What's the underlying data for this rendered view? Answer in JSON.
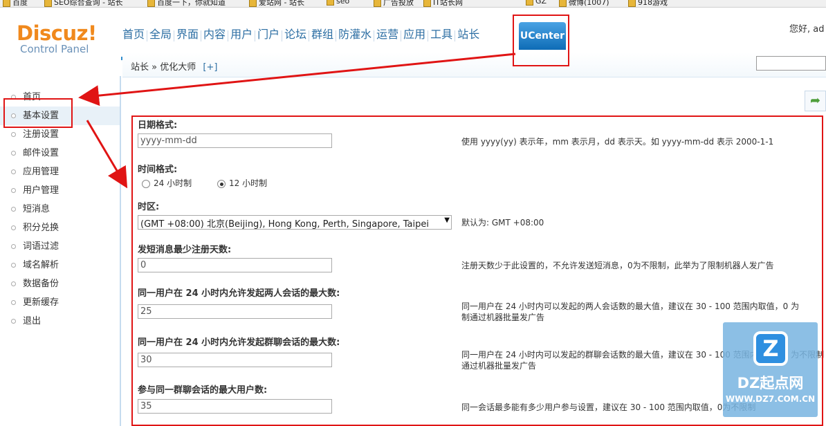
{
  "bookmarks": [
    "百度",
    "SEO综合查询 - 站长",
    "百度一下，你就知道",
    "爱站网 - 站长",
    "seo",
    "广告投放",
    "IT站长网",
    "GZ",
    "微博(1007)",
    "918游戏"
  ],
  "logo": {
    "main": "Discuz!",
    "sub": "Control Panel"
  },
  "nav": {
    "items": [
      "首页",
      "全局",
      "界面",
      "内容",
      "用户",
      "门户",
      "论坛",
      "群组",
      "防灌水",
      "运营",
      "应用",
      "工具",
      "站长"
    ],
    "active": "UCenter"
  },
  "user": {
    "greeting": "您好, ad"
  },
  "breadcrumb": {
    "root": "站长",
    "sep": "»",
    "current": "优化大师",
    "plus": "[+]"
  },
  "sidebar": {
    "items": [
      "首页",
      "基本设置",
      "注册设置",
      "邮件设置",
      "应用管理",
      "用户管理",
      "短消息",
      "积分兑换",
      "词语过滤",
      "域名解析",
      "数据备份",
      "更新缓存",
      "退出"
    ],
    "active_index": 1
  },
  "form": {
    "date_format": {
      "label": "日期格式:",
      "value": "yyyy-mm-dd",
      "tip": "使用 yyyy(yy) 表示年，mm 表示月，dd 表示天。如 yyyy-mm-dd 表示 2000-1-1"
    },
    "time_format": {
      "label": "时间格式:",
      "opt24": "24 小时制",
      "opt12": "12 小时制",
      "selected": "12"
    },
    "timezone": {
      "label": "时区:",
      "value": "(GMT +08:00) 北京(Beijing), Hong Kong, Perth, Singapore, Taipei",
      "tip": "默认为: GMT +08:00"
    },
    "pm_min_days": {
      "label": "发短消息最少注册天数:",
      "value": "0",
      "tip": "注册天数少于此设置的，不允许发送短消息，0为不限制，此举为了限制机器人发广告"
    },
    "pm_max_private": {
      "label": "同一用户在 24 小时内允许发起两人会话的最大数:",
      "value": "25",
      "tip1": "同一用户在 24 小时内可以发起的两人会话数的最大值，建议在 30 - 100 范围内取值，0 为",
      "tip2": "制通过机器批量发广告"
    },
    "pm_max_group": {
      "label": "同一用户在 24 小时内允许发起群聊会话的最大数:",
      "value": "30",
      "tip1": "同一用户在 24 小时内可以发起的群聊会话数的最大值，建议在 30 - 100 范围内取值，0 为不限制",
      "tip2": "通过机器批量发广告"
    },
    "pm_max_members": {
      "label": "参与同一群聊会话的最大用户数:",
      "value": "35",
      "tip": "同一会话最多能有多少用户参与设置，建议在 30 - 100 范围内取值，0为不限制"
    }
  },
  "watermark": {
    "logo": "Z",
    "text": "DZ起点网",
    "url": "WWW.DZ7.COM.CN"
  },
  "colors": {
    "annotation": "#e01414",
    "nav_blue": "#2c6ea3",
    "nav_line": "#2f8ccc",
    "logo_orange": "#f0891d"
  }
}
